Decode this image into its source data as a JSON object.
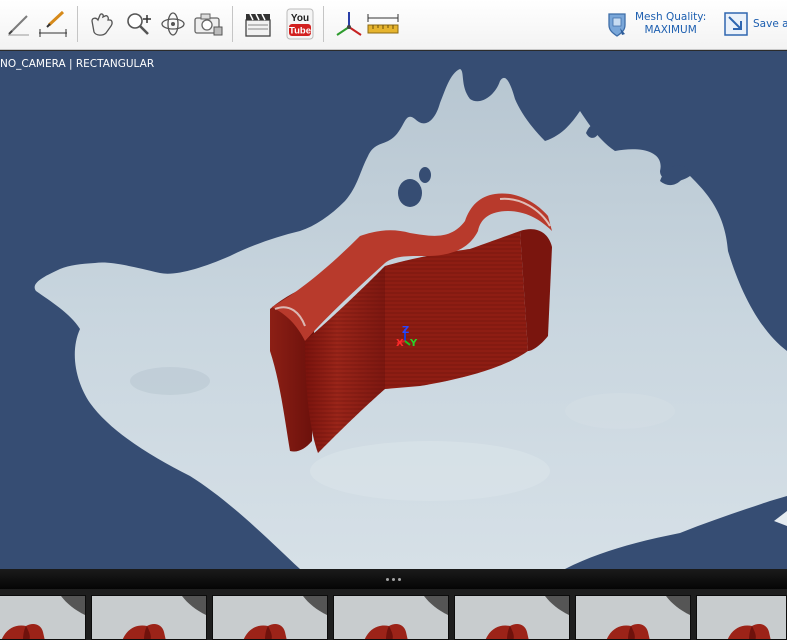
{
  "toolbar": {
    "tools": [
      {
        "name": "pencil-icon"
      },
      {
        "name": "measure-pencil-icon"
      },
      {
        "name": "pan-hand-icon"
      },
      {
        "name": "zoom-in-icon"
      },
      {
        "name": "rotate-icon"
      },
      {
        "name": "camera-icon"
      },
      {
        "name": "clapperboard-icon"
      },
      {
        "name": "youtube-icon"
      },
      {
        "name": "axes-icon"
      },
      {
        "name": "ruler-icon"
      }
    ],
    "youtube_label_top": "You",
    "youtube_label_bottom": "Tube",
    "mesh_quality_label": "Mesh Quality:",
    "mesh_quality_value": "MAXIMUM",
    "save_label": "Save a"
  },
  "viewport": {
    "camera_label": "NO_CAMERA | RECTANGULAR",
    "gizmo": {
      "z": "Z",
      "x": "X",
      "y": "Y"
    },
    "colors": {
      "background": "#364d73",
      "surface": "#c5d2dc",
      "object": "#8e1e14"
    }
  },
  "filmstrip": {
    "thumbnails": [
      1,
      2,
      3,
      4,
      5,
      6,
      7
    ]
  }
}
